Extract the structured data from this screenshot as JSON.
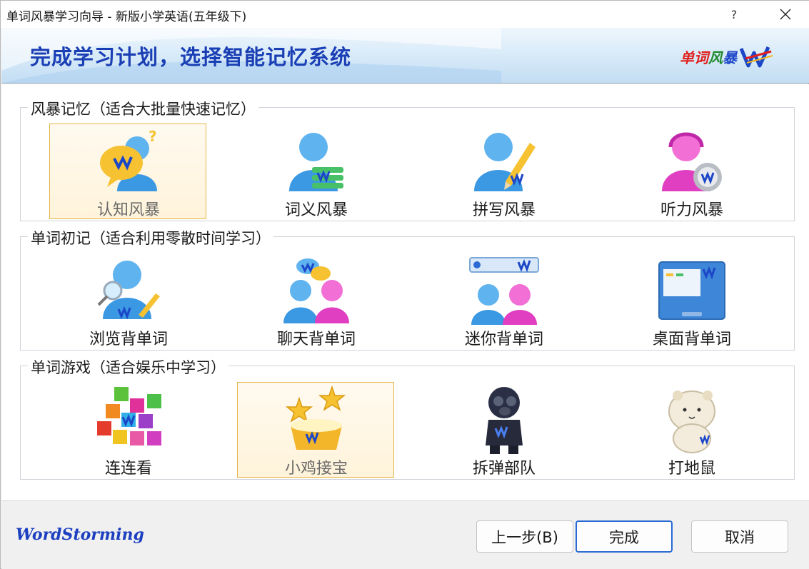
{
  "window": {
    "title": "单词风暴学习向导 - 新版小学英语(五年级下)",
    "help_glyph": "?"
  },
  "banner": {
    "heading": "完成学习计划，选择智能记忆系统",
    "logo_text_1": "单词",
    "logo_text_2": "风",
    "logo_text_3": "暴",
    "logo_mark": "logo-icon"
  },
  "groups": [
    {
      "legend": "风暴记忆（适合大批量快速记忆）",
      "items": [
        {
          "label": "认知风暴",
          "icon": "cognition-icon",
          "selected": true
        },
        {
          "label": "词义风暴",
          "icon": "meaning-icon",
          "selected": false
        },
        {
          "label": "拼写风暴",
          "icon": "spelling-icon",
          "selected": false
        },
        {
          "label": "听力风暴",
          "icon": "listening-icon",
          "selected": false
        }
      ]
    },
    {
      "legend": "单词初记（适合利用零散时间学习）",
      "items": [
        {
          "label": "浏览背单词",
          "icon": "browse-icon",
          "selected": false
        },
        {
          "label": "聊天背单词",
          "icon": "chat-icon",
          "selected": false
        },
        {
          "label": "迷你背单词",
          "icon": "mini-icon",
          "selected": false
        },
        {
          "label": "桌面背单词",
          "icon": "desktop-icon",
          "selected": false
        }
      ]
    },
    {
      "legend": "单词游戏（适合娱乐中学习）",
      "items": [
        {
          "label": "连连看",
          "icon": "blocks-icon",
          "selected": false
        },
        {
          "label": "小鸡接宝",
          "icon": "stars-bowl-icon",
          "selected": true
        },
        {
          "label": "拆弹部队",
          "icon": "bomb-squad-icon",
          "selected": false
        },
        {
          "label": "打地鼠",
          "icon": "hamster-icon",
          "selected": false
        }
      ]
    }
  ],
  "footer": {
    "brand": "WordStorming",
    "prev_label": "上一步(B)",
    "done_label": "完成",
    "cancel_label": "取消"
  },
  "colors": {
    "heading": "#1a3fb5",
    "selected_border": "#e6b54a",
    "primary_button_border": "#2b6bd6",
    "brand": "#1c3fc0"
  }
}
